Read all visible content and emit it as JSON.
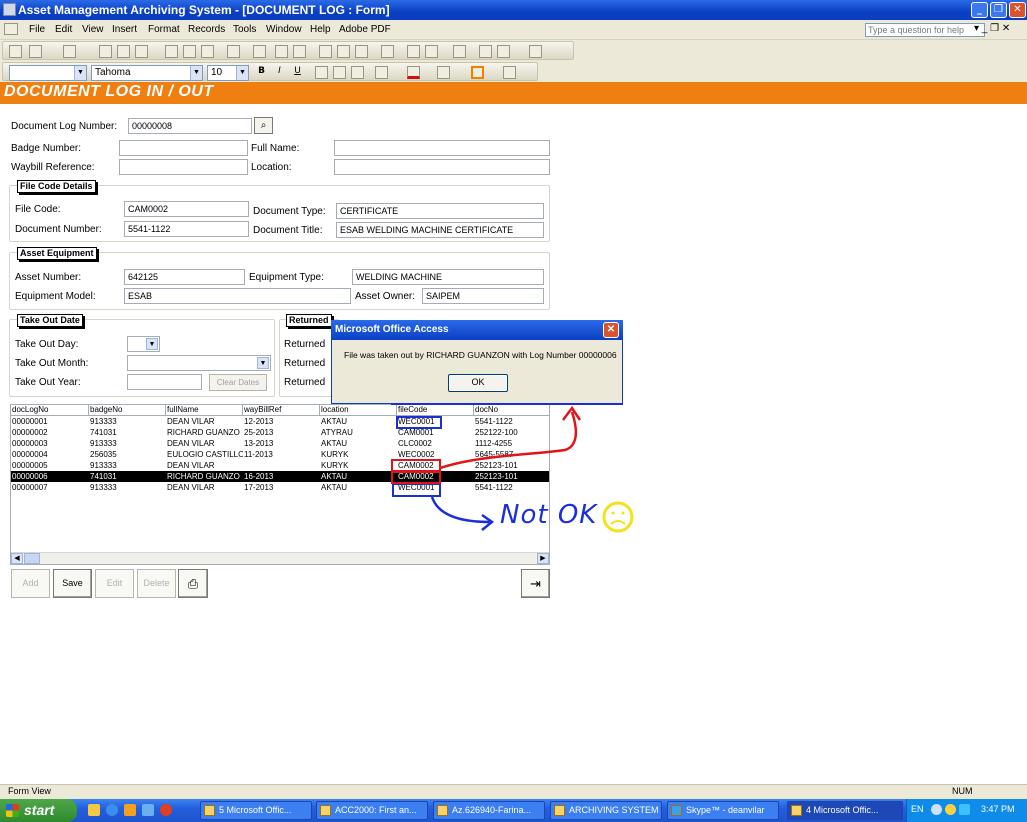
{
  "window": {
    "title": "Asset Management Archiving System - [DOCUMENT LOG : Form]",
    "min": "_",
    "restore": "❐",
    "close": "✕"
  },
  "menu": {
    "items": [
      "File",
      "Edit",
      "View",
      "Insert",
      "Format",
      "Records",
      "Tools",
      "Window",
      "Help",
      "Adobe PDF"
    ],
    "help_placeholder": "Type a question for help",
    "right_controls": "▾ _ ❐ ✕"
  },
  "format_toolbar": {
    "font": "Tahoma",
    "size": "10",
    "bold": "B",
    "italic": "I",
    "underline": "U"
  },
  "form": {
    "header": "DOCUMENT LOG IN / OUT",
    "doc_log_number_label": "Document Log Number:",
    "doc_log_number": "00000008",
    "badge_label": "Badge Number:",
    "badge_value": "",
    "fullname_label": "Full Name:",
    "fullname_value": "",
    "waybill_label": "Waybill Reference:",
    "waybill_value": "",
    "location_label": "Location:",
    "location_value": "",
    "file_code_group": {
      "title": "File Code Details",
      "file_code_label": "File Code:",
      "file_code": "CAM0002",
      "doc_type_label": "Document Type:",
      "doc_type": "CERTIFICATE",
      "doc_number_label": "Document Number:",
      "doc_number": "5541-1122",
      "doc_title_label": "Document Title:",
      "doc_title": "ESAB WELDING MACHINE CERTIFICATE"
    },
    "asset_group": {
      "title": "Asset Equipment",
      "asset_number_label": "Asset Number:",
      "asset_number": "642125",
      "equip_type_label": "Equipment Type:",
      "equip_type": "WELDING MACHINE",
      "equip_model_label": "Equipment Model:",
      "equip_model": "ESAB",
      "asset_owner_label": "Asset Owner:",
      "asset_owner": "SAIPEM"
    },
    "takeout_group": {
      "title": "Take Out Date",
      "day_label": "Take Out Day:",
      "month_label": "Take Out  Month:",
      "year_label": "Take Out  Year:",
      "clear_dates": "Clear Dates"
    },
    "returned_group": {
      "title": "Returned",
      "label1": "Returned",
      "label2": "Returned",
      "label3": "Returned"
    }
  },
  "grid": {
    "columns": [
      "docLogNo",
      "badgeNo",
      "fullName",
      "wayBillRef",
      "location",
      "fileCode",
      "docNo"
    ],
    "rows": [
      [
        "00000001",
        "913333",
        "DEAN VILAR",
        "12-2013",
        "AKTAU",
        "WEC0001",
        "5541-1122"
      ],
      [
        "00000002",
        "741031",
        "RICHARD GUANZO",
        "25-2013",
        "ATYRAU",
        "CAM0001",
        "252122-100"
      ],
      [
        "00000003",
        "913333",
        "DEAN VILAR",
        "13-2013",
        "AKTAU",
        "CLC0002",
        "1112-4255"
      ],
      [
        "00000004",
        "256035",
        "EULOGIO CASTILLO",
        "11-2013",
        "KURYK",
        "WEC0002",
        "5645-5587"
      ],
      [
        "00000005",
        "913333",
        "DEAN VILAR",
        "",
        "KURYK",
        "CAM0002",
        "252123-101"
      ],
      [
        "00000006",
        "741031",
        "RICHARD GUANZO",
        "16-2013",
        "AKTAU",
        "CAM0002",
        "252123-101"
      ],
      [
        "00000007",
        "913333",
        "DEAN VILAR",
        "17-2013",
        "AKTAU",
        "WEC0001",
        "5541-1122"
      ]
    ],
    "selected_row": 5
  },
  "buttons": {
    "add": "Add",
    "save": "Save",
    "edit": "Edit",
    "delete": "Delete"
  },
  "dialog": {
    "title": "Microsoft Office Access",
    "message": "File was taken out by RICHARD GUANZON with Log Number 00000006",
    "ok": "OK"
  },
  "annotation": {
    "text": "Not OK",
    "colors": {
      "blue": "#1a2fd8",
      "red": "#e0141a",
      "yellow": "#f2e21a"
    }
  },
  "status": {
    "left": "Form View",
    "num": "NUM"
  },
  "taskbar": {
    "start": "start",
    "tasks": [
      "5 Microsoft Offic...",
      "ACC2000: First an...",
      "Az.626940-Farina...",
      "ARCHIVING SYSTEM",
      "Skype™ - deanvilar",
      "4 Microsoft Offic..."
    ],
    "lang": "EN",
    "time": "3:47 PM"
  }
}
